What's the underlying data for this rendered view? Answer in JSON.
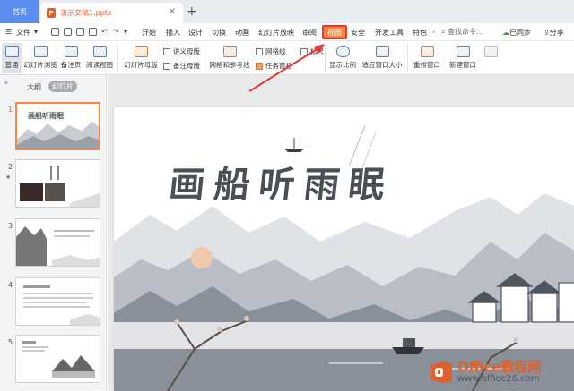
{
  "tabs": {
    "home": "首页",
    "doc": "演示文稿1.pptx",
    "close": "✕",
    "add": "+"
  },
  "menu": {
    "file": "文件",
    "items": [
      "开始",
      "插入",
      "设计",
      "切换",
      "动画",
      "幻灯片放映",
      "审阅"
    ],
    "view": "视图",
    "after": [
      "安全",
      "开发工具",
      "特色"
    ],
    "search": "查找命令...",
    "sync": "已同步",
    "share": "分享"
  },
  "ribbon": {
    "normal": "普通",
    "sorter": "幻灯片浏览",
    "notes_page": "备注页",
    "reading": "阅读视图",
    "slide_master": "幻灯片母版",
    "handout_master": "讲义母版",
    "notes_master": "备注母版",
    "grid_guides": "网格和参考线",
    "gridlines": "网格线",
    "ruler": "标尺",
    "taskpane": "任务窗格",
    "zoom": "显示比例",
    "fit_window": "适应窗口大小",
    "arrange": "重排窗口",
    "new_window": "新建窗口"
  },
  "panel": {
    "collapse": "«",
    "outline": "大纲",
    "slides_tab": "幻灯片",
    "numbers": [
      "1",
      "2",
      "3",
      "4",
      "5"
    ],
    "star": "★"
  },
  "slide": {
    "title": "画船听雨眠"
  },
  "watermark": {
    "line1": "Office教程网",
    "line2": "www.office26.com"
  },
  "colors": {
    "accent": "#e0602c",
    "highlight": "#e53935",
    "tab_blue": "#5b8def"
  }
}
